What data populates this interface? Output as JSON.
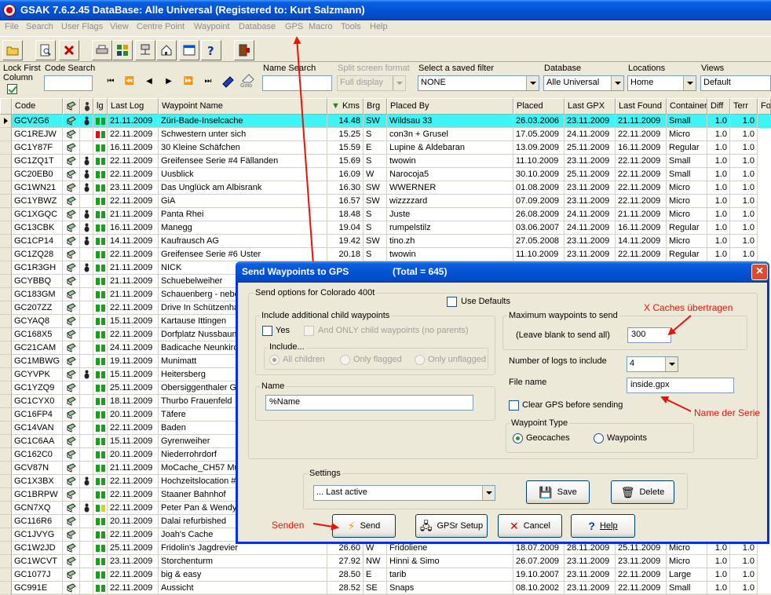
{
  "window": {
    "title": "GSAK 7.6.2.45    DataBase: Alle Universal    (Registered to: Kurt Salzmann)"
  },
  "menu": [
    "File",
    "Search",
    "User Flags",
    "View",
    "Centre Point",
    "Waypoint",
    "Database",
    "GPS",
    "Macro",
    "Tools",
    "Help"
  ],
  "toolbar": {
    "buttons": [
      {
        "icon": "open-folder-icon"
      },
      {
        "icon": "document-search-icon"
      },
      {
        "icon": "delete-x-icon"
      },
      {
        "icon": "printer-icon"
      },
      {
        "icon": "grid-icon"
      },
      {
        "icon": "network-icon"
      },
      {
        "icon": "home-icon"
      },
      {
        "icon": "window-icon"
      },
      {
        "icon": "help-icon"
      },
      {
        "icon": "exit-icon"
      }
    ]
  },
  "filter": {
    "lock_first_column": "Lock First Column",
    "code_search": "Code Search",
    "name_search": "Name Search",
    "split_screen_label": "Split screen format",
    "split_screen_value": "Full display",
    "saved_filter_label": "Select a saved filter",
    "saved_filter_value": "NONE",
    "database_label": "Database",
    "database_value": "Alle Universal",
    "locations_label": "Locations",
    "locations_value": "Home",
    "views_label": "Views",
    "views_value": "Default",
    "goto_label": "Goto",
    "nav": [
      "⏮",
      "⏪",
      "◀",
      "▶",
      "⏩",
      "⏭"
    ]
  },
  "grid": {
    "columns": [
      "Code",
      "",
      "",
      "lg",
      "Last Log",
      "Waypoint Name",
      "Kms",
      "Brg",
      "Placed By",
      "Placed",
      "Last GPX",
      "Last Found",
      "Container",
      "Diff",
      "Terr",
      "Fo"
    ],
    "rows": [
      [
        "GCV2G6",
        "21.11.2009",
        "Züri-Bade-Inselcache",
        "14.48",
        "SW",
        "Wildsau 33",
        "26.03.2006",
        "23.11.2009",
        "21.11.2009",
        "Small",
        "1.0",
        "1.0"
      ],
      [
        "GC1REJW",
        "22.11.2009",
        "Schwestern unter sich",
        "15.25",
        "S",
        "con3n + Grusel",
        "17.05.2009",
        "24.11.2009",
        "22.11.2009",
        "Micro",
        "1.0",
        "1.0"
      ],
      [
        "GC1Y87F",
        "16.11.2009",
        "30 Kleine Schäfchen",
        "15.59",
        "E",
        "Lupine & Aldebaran",
        "13.09.2009",
        "25.11.2009",
        "16.11.2009",
        "Regular",
        "1.0",
        "1.0"
      ],
      [
        "GC1ZQ1T",
        "22.11.2009",
        "Greifensee Serie #4 Fällanden",
        "15.69",
        "S",
        "twowin",
        "11.10.2009",
        "23.11.2009",
        "22.11.2009",
        "Small",
        "1.0",
        "1.0"
      ],
      [
        "GC20EB0",
        "22.11.2009",
        "Uusblick",
        "16.09",
        "W",
        "Narocoja5",
        "30.10.2009",
        "25.11.2009",
        "22.11.2009",
        "Small",
        "1.0",
        "1.0"
      ],
      [
        "GC1WN21",
        "23.11.2009",
        "Das Unglück am Albisrank",
        "16.30",
        "SW",
        "WWERNER",
        "01.08.2009",
        "23.11.2009",
        "22.11.2009",
        "Micro",
        "1.0",
        "1.0"
      ],
      [
        "GC1YBWZ",
        "22.11.2009",
        "GiA",
        "16.57",
        "SW",
        "wizzzzard",
        "07.09.2009",
        "23.11.2009",
        "22.11.2009",
        "Micro",
        "1.0",
        "1.0"
      ],
      [
        "GC1XGQC",
        "21.11.2009",
        "Panta Rhei",
        "18.48",
        "S",
        "Juste",
        "26.08.2009",
        "24.11.2009",
        "21.11.2009",
        "Micro",
        "1.0",
        "1.0"
      ],
      [
        "GC13CBK",
        "16.11.2009",
        "Manegg",
        "19.04",
        "S",
        "rumpelstilz",
        "03.06.2007",
        "24.11.2009",
        "16.11.2009",
        "Regular",
        "1.0",
        "1.0"
      ],
      [
        "GC1CP14",
        "14.11.2009",
        "Kaufrausch AG",
        "19.42",
        "SW",
        "tino.zh",
        "27.05.2008",
        "23.11.2009",
        "14.11.2009",
        "Micro",
        "1.0",
        "1.0"
      ],
      [
        "GC1ZQ28",
        "22.11.2009",
        "Greifensee Serie #6 Uster",
        "20.18",
        "S",
        "twowin",
        "11.10.2009",
        "23.11.2009",
        "22.11.2009",
        "Regular",
        "1.0",
        "1.0"
      ],
      [
        "GC1R3GH",
        "21.11.2009",
        "NICK",
        "",
        "",
        "",
        "",
        "",
        "",
        "",
        "",
        ""
      ],
      [
        "GCYBBQ",
        "21.11.2009",
        "Schuebelweiher",
        "",
        "",
        "",
        "",
        "",
        "",
        "",
        "",
        ""
      ],
      [
        "GC183GM",
        "21.11.2009",
        "Schauenberg - nebe",
        "",
        "",
        "",
        "",
        "",
        "",
        "",
        "",
        ""
      ],
      [
        "GC207ZZ",
        "22.11.2009",
        "Drive In Schützenha",
        "",
        "",
        "",
        "",
        "",
        "",
        "",
        "",
        ""
      ],
      [
        "GCYAQ8",
        "15.11.2009",
        "Kartause Ittingen",
        "",
        "",
        "",
        "",
        "",
        "",
        "",
        "",
        ""
      ],
      [
        "GC168X5",
        "22.11.2009",
        "Dorfplatz Nussbaum",
        "",
        "",
        "",
        "",
        "",
        "",
        "",
        "",
        ""
      ],
      [
        "GC21CAM",
        "24.11.2009",
        "Badicache Neunkirc",
        "",
        "",
        "",
        "",
        "",
        "",
        "",
        "",
        ""
      ],
      [
        "GC1MBWG",
        "19.11.2009",
        "Munimatt",
        "",
        "",
        "",
        "",
        "",
        "",
        "",
        "",
        ""
      ],
      [
        "GCYVPK",
        "15.11.2009",
        "Heitersberg",
        "",
        "",
        "",
        "",
        "",
        "",
        "",
        "",
        ""
      ],
      [
        "GC1YZQ9",
        "25.11.2009",
        "Obersiggenthaler Gr",
        "",
        "",
        "",
        "",
        "",
        "",
        "",
        "",
        ""
      ],
      [
        "GC1CYX0",
        "18.11.2009",
        "Thurbo Frauenfeld",
        "",
        "",
        "",
        "",
        "",
        "",
        "",
        "",
        ""
      ],
      [
        "GC16FP4",
        "20.11.2009",
        "Täfere",
        "",
        "",
        "",
        "",
        "",
        "",
        "",
        "",
        ""
      ],
      [
        "GC14VAN",
        "22.11.2009",
        "Baden",
        "",
        "",
        "",
        "",
        "",
        "",
        "",
        "",
        ""
      ],
      [
        "GC1C6AA",
        "15.11.2009",
        "Gyrenweiher",
        "",
        "",
        "",
        "",
        "",
        "",
        "",
        "",
        ""
      ],
      [
        "GC162C0",
        "20.11.2009",
        "Niederrohrdorf",
        "",
        "",
        "",
        "",
        "",
        "",
        "",
        "",
        ""
      ],
      [
        "GCV87N",
        "21.11.2009",
        "MoCache_CH57 Mu",
        "",
        "",
        "",
        "",
        "",
        "",
        "",
        "",
        ""
      ],
      [
        "GC1X3BX",
        "22.11.2009",
        "Hochzeitslocation #",
        "",
        "",
        "",
        "",
        "",
        "",
        "",
        "",
        ""
      ],
      [
        "GC1BRPW",
        "22.11.2009",
        "Staaner Bahnhof",
        "",
        "",
        "",
        "",
        "",
        "",
        "",
        "",
        ""
      ],
      [
        "GCN7XQ",
        "22.11.2009",
        "Peter Pan & Wendy",
        "",
        "",
        "",
        "",
        "",
        "",
        "",
        "",
        ""
      ],
      [
        "GC116R6",
        "20.11.2009",
        "Dalai refurbished",
        "",
        "",
        "",
        "",
        "",
        "",
        "",
        "",
        ""
      ],
      [
        "GC1JVYG",
        "22.11.2009",
        "Joah's Cache",
        "",
        "",
        "",
        "",
        "",
        "",
        "",
        "",
        ""
      ],
      [
        "GC1W2JD",
        "25.11.2009",
        "Fridolin's Jagdrevier",
        "26.60",
        "W",
        "Fridoliene",
        "18.07.2009",
        "28.11.2009",
        "25.11.2009",
        "Micro",
        "1.0",
        "1.0"
      ],
      [
        "GC1WCVT",
        "23.11.2009",
        "Storchenturm",
        "27.92",
        "NW",
        "Hinni & Simo",
        "26.07.2009",
        "23.11.2009",
        "23.11.2009",
        "Micro",
        "1.0",
        "1.0"
      ],
      [
        "GC1077J",
        "22.11.2009",
        "big & easy",
        "28.50",
        "E",
        "tarib",
        "19.10.2007",
        "23.11.2009",
        "22.11.2009",
        "Large",
        "1.0",
        "1.0"
      ],
      [
        "GC991E",
        "22.11.2009",
        "Aussicht",
        "28.52",
        "SE",
        "Snaps",
        "08.10.2002",
        "23.11.2009",
        "22.11.2009",
        "Small",
        "1.0",
        "1.0"
      ]
    ],
    "flagged_rows": [
      0,
      3,
      4,
      5,
      7,
      8,
      9,
      11,
      19,
      27,
      29
    ]
  },
  "dialog": {
    "title": "Send Waypoints to GPS",
    "total": "(Total = 645)",
    "send_options": "Send options for Colorado 400t",
    "use_defaults": "Use Defaults",
    "child_group": "Include additional child waypoints",
    "yes": "Yes",
    "only_child": "And ONLY child waypoints (no parents)",
    "include_group": "Include...",
    "all_children": "All children",
    "only_flagged": "Only flagged",
    "only_unflagged": "Only unflagged",
    "max_group": "Maximum waypoints to send",
    "leave_blank": "(Leave blank to send all)",
    "max_value": "300",
    "logs_label": "Number of logs to include",
    "logs_value": "4",
    "file_label": "File name",
    "file_value": "inside.gpx",
    "clear_gps": "Clear GPS before sending",
    "name_group": "Name",
    "name_value": "%Name",
    "wpt_type_group": "Waypoint Type",
    "geocaches": "Geocaches",
    "waypoints": "Waypoints",
    "settings_group": "Settings",
    "settings_value": "... Last active",
    "save": "Save",
    "delete": "Delete",
    "send": "Send",
    "gpsr_setup": "GPSr Setup",
    "cancel": "Cancel",
    "help": "Help"
  },
  "annotations": {
    "x_caches": "X Caches übertragen",
    "name_serie": "Name der Serie",
    "senden": "Senden"
  },
  "colors": {
    "selection": "#3ff4f4",
    "title_blue": "#0553d5",
    "annotation_red": "#e8140c",
    "flag_green": "#19a119"
  }
}
